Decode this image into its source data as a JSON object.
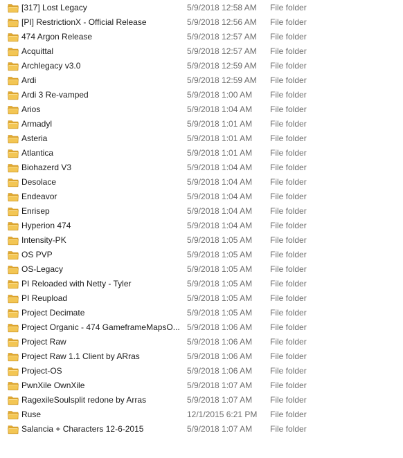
{
  "colors": {
    "folder_fill": "#F3C654",
    "folder_back": "#E2A92E",
    "folder_edge": "#C9901F",
    "name_text": "#1B1B1B",
    "meta_text": "#6D6D6D"
  },
  "folder_icon": "folder-icon",
  "rows": [
    {
      "name": "[317] Lost Legacy",
      "date": "5/9/2018 12:58 AM",
      "type": "File folder"
    },
    {
      "name": "[PI] RestrictionX - Official Release",
      "date": "5/9/2018 12:56 AM",
      "type": "File folder"
    },
    {
      "name": "474 Argon Release",
      "date": "5/9/2018 12:57 AM",
      "type": "File folder"
    },
    {
      "name": "Acquittal",
      "date": "5/9/2018 12:57 AM",
      "type": "File folder"
    },
    {
      "name": "Archlegacy v3.0",
      "date": "5/9/2018 12:59 AM",
      "type": "File folder"
    },
    {
      "name": "Ardi",
      "date": "5/9/2018 12:59 AM",
      "type": "File folder"
    },
    {
      "name": "Ardi 3 Re-vamped",
      "date": "5/9/2018 1:00 AM",
      "type": "File folder"
    },
    {
      "name": "Arios",
      "date": "5/9/2018 1:04 AM",
      "type": "File folder"
    },
    {
      "name": "Armadyl",
      "date": "5/9/2018 1:01 AM",
      "type": "File folder"
    },
    {
      "name": "Asteria",
      "date": "5/9/2018 1:01 AM",
      "type": "File folder"
    },
    {
      "name": "Atlantica",
      "date": "5/9/2018 1:01 AM",
      "type": "File folder"
    },
    {
      "name": "Biohazerd V3",
      "date": "5/9/2018 1:04 AM",
      "type": "File folder"
    },
    {
      "name": "Desolace",
      "date": "5/9/2018 1:04 AM",
      "type": "File folder"
    },
    {
      "name": "Endeavor",
      "date": "5/9/2018 1:04 AM",
      "type": "File folder"
    },
    {
      "name": "Enrisep",
      "date": "5/9/2018 1:04 AM",
      "type": "File folder"
    },
    {
      "name": "Hyperion 474",
      "date": "5/9/2018 1:04 AM",
      "type": "File folder"
    },
    {
      "name": "Intensity-PK",
      "date": "5/9/2018 1:05 AM",
      "type": "File folder"
    },
    {
      "name": "OS PVP",
      "date": "5/9/2018 1:05 AM",
      "type": "File folder"
    },
    {
      "name": "OS-Legacy",
      "date": "5/9/2018 1:05 AM",
      "type": "File folder"
    },
    {
      "name": "PI Reloaded with Netty - Tyler",
      "date": "5/9/2018 1:05 AM",
      "type": "File folder"
    },
    {
      "name": "PI Reupload",
      "date": "5/9/2018 1:05 AM",
      "type": "File folder"
    },
    {
      "name": "Project Decimate",
      "date": "5/9/2018 1:05 AM",
      "type": "File folder"
    },
    {
      "name": "Project Organic - 474 GameframeMapsO...",
      "date": "5/9/2018 1:06 AM",
      "type": "File folder"
    },
    {
      "name": "Project Raw",
      "date": "5/9/2018 1:06 AM",
      "type": "File folder"
    },
    {
      "name": "Project Raw 1.1 Client by ARras",
      "date": "5/9/2018 1:06 AM",
      "type": "File folder"
    },
    {
      "name": "Project-OS",
      "date": "5/9/2018 1:06 AM",
      "type": "File folder"
    },
    {
      "name": "PwnXile OwnXile",
      "date": "5/9/2018 1:07 AM",
      "type": "File folder"
    },
    {
      "name": "RagexileSoulsplit redone by Arras",
      "date": "5/9/2018 1:07 AM",
      "type": "File folder"
    },
    {
      "name": "Ruse",
      "date": "12/1/2015 6:21 PM",
      "type": "File folder"
    },
    {
      "name": "Salancia + Characters 12-6-2015",
      "date": "5/9/2018 1:07 AM",
      "type": "File folder"
    }
  ]
}
